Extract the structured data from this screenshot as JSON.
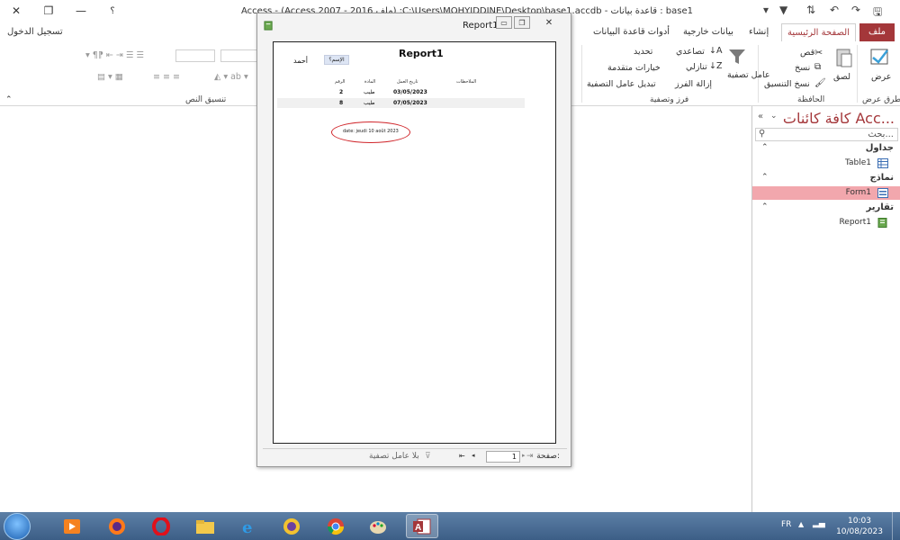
{
  "window": {
    "title": "Access - (Access 2007 - 2016 ملف) :C:\\Users\\MOHYIDDINE\\Desktop\\base1.accdb - قاعدة بيانات : base1",
    "help": "؟",
    "signin": "تسجيل الدخول"
  },
  "tabs": [
    {
      "label": "ملف"
    },
    {
      "label": "الصفحة الرئيسية"
    },
    {
      "label": "إنشاء"
    },
    {
      "label": "بيانات خارجية"
    },
    {
      "label": "أدوات قاعدة البيانات"
    }
  ],
  "ribbon": {
    "groups": {
      "views": "طرق عرض",
      "clipboard": "الحافظة",
      "sort_filter": "فرز وتصفية",
      "text_format": "تنسيق النص"
    },
    "view_btn": "عرض",
    "paste_btn": "لصق",
    "cut": "قص",
    "copy": "نسخ",
    "format_painter": "نسخ التنسيق",
    "filter_btn": "عامل تصفية",
    "ascending": "تصاعدي",
    "descending": "تنازلي",
    "remove_sort": "إزالة الفرز",
    "selection": "تحديد",
    "advanced": "خيارات متقدمة",
    "toggle_filter": "تبديل عامل التصفية"
  },
  "nav": {
    "title": "كافة كائنات Acc...",
    "search_placeholder": "بحث...",
    "sections": {
      "tables": "جداول",
      "forms": "نماذج",
      "reports": "تقارير"
    },
    "items": {
      "table1": "Table1",
      "form1": "Form1",
      "report1": "Report1"
    }
  },
  "report_window": {
    "title": "Report1",
    "report_title": "Report1",
    "button_label": "الإسم؟",
    "label": "أحمد",
    "headers": [
      "الرقم",
      "المادة",
      "تاريخ العمل",
      "الملاحظات"
    ],
    "rows": [
      {
        "num": "2",
        "item": "طيب",
        "date": "03/05/2023"
      },
      {
        "num": "8",
        "item": "طيب",
        "date": "07/05/2023"
      }
    ],
    "date_field": "date:   jeudi 10 août 2023",
    "status_page_label": "صفحة:",
    "page_number": "1",
    "no_filter": "بلا عامل تصفية"
  },
  "taskbar": {
    "lang": "FR",
    "time": "10:03",
    "date": "10/08/2023"
  },
  "colors": {
    "accent": "#a4373a",
    "nav_selected": "#f2a7ad",
    "taskbar": "#4a6d95",
    "highlight_ellipse": "#d0252a"
  }
}
